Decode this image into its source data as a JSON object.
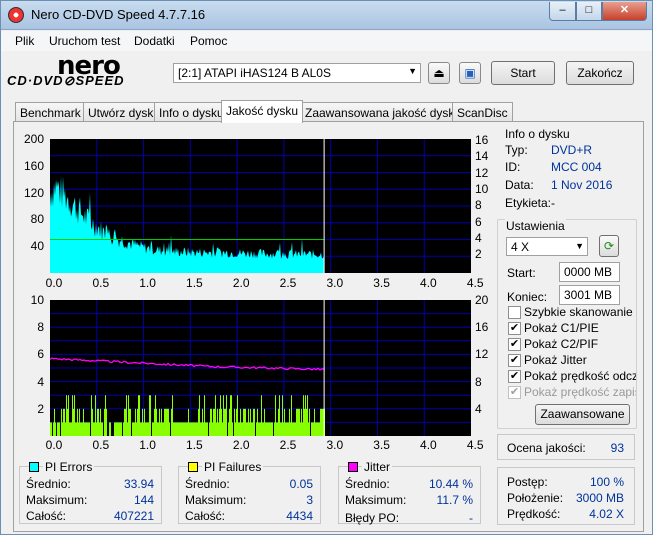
{
  "window": {
    "title": "Nero CD-DVD Speed 4.7.7.16",
    "minimize": "–",
    "maximize": "□",
    "close": "✕"
  },
  "menu": [
    "Plik",
    "Uruchom test",
    "Dodatki",
    "Pomoc"
  ],
  "logo": {
    "line1": "nero",
    "line2": "CD·DVD⊘SPEED"
  },
  "toolbar": {
    "drive": "[2:1]   ATAPI iHAS124   B AL0S",
    "start": "Start",
    "exit": "Zakończ"
  },
  "tabs": [
    "Benchmark",
    "Utwórz dysk",
    "Info o dysku",
    "Jakość dysku",
    "Zaawansowana jakość dysku",
    "ScanDisc"
  ],
  "top_chart": {
    "left_ticks": [
      "200",
      "160",
      "120",
      "80",
      "40"
    ],
    "right_ticks": [
      "16",
      "14",
      "12",
      "10",
      "8",
      "6",
      "4",
      "2"
    ],
    "x_ticks": [
      "0.0",
      "0.5",
      "1.0",
      "1.5",
      "2.0",
      "2.5",
      "3.0",
      "3.5",
      "4.0",
      "4.5"
    ]
  },
  "bottom_chart": {
    "left_ticks": [
      "10",
      "8",
      "6",
      "4",
      "2"
    ],
    "right_ticks": [
      "20",
      "16",
      "12",
      "8",
      "4"
    ],
    "x_ticks": [
      "0.0",
      "0.5",
      "1.0",
      "1.5",
      "2.0",
      "2.5",
      "3.0",
      "3.5",
      "4.0",
      "4.5"
    ]
  },
  "chart_data": [
    {
      "type": "area",
      "x": [
        0.0,
        0.05,
        0.1,
        0.2,
        0.3,
        0.4,
        0.5,
        0.6,
        0.7,
        0.8,
        0.9,
        1.0,
        1.2,
        1.5,
        2.0,
        2.5,
        2.93
      ],
      "series": [
        {
          "values": [
            120,
            130,
            125,
            110,
            95,
            80,
            70,
            58,
            52,
            48,
            42,
            38,
            33,
            31,
            30,
            28,
            28
          ]
        }
      ],
      "markers": [
        {
          "values": [
            50
          ]
        }
      ],
      "xlim": [
        0,
        4.5
      ],
      "ylim": [
        0,
        200
      ],
      "y2lim": [
        0,
        16
      ],
      "colors": {
        "area": "#00ffff",
        "marker": "#00cc00",
        "grid": "#0000aa",
        "cursor": "#ffffff"
      }
    },
    {
      "type": "bar",
      "x_range": [
        0,
        2.93
      ],
      "series": [
        {
          "values": [
            2,
            3,
            1,
            2,
            3,
            1
          ]
        },
        {
          "values": [
            5.7,
            5.5,
            5.3,
            5.1,
            5.0,
            4.9
          ]
        }
      ],
      "xlim": [
        0,
        4.5
      ],
      "ylim": [
        0,
        10
      ],
      "y2lim": [
        0,
        20
      ],
      "colors": {
        "bars": "#88ff00",
        "jitter": "#ff00ff",
        "grid": "#0000aa"
      }
    }
  ],
  "info": {
    "title": "Info o dysku",
    "type_label": "Typ:",
    "type": "DVD+R",
    "id_label": "ID:",
    "id": "MCC 004",
    "date_label": "Data:",
    "date": "1 Nov 2016",
    "label_label": "Etykieta:",
    "label": "-"
  },
  "settings": {
    "title": "Ustawienia",
    "speed": "4 X",
    "start_label": "Start:",
    "start": "0000 MB",
    "end_label": "Koniec:",
    "end": "3001 MB",
    "checkboxes": [
      {
        "label": "Szybkie skanowanie",
        "checked": false,
        "disabled": false
      },
      {
        "label": "Pokaż C1/PIE",
        "checked": true,
        "disabled": false
      },
      {
        "label": "Pokaż C2/PIF",
        "checked": true,
        "disabled": false
      },
      {
        "label": "Pokaż Jitter",
        "checked": true,
        "disabled": false
      },
      {
        "label": "Pokaż prędkość odczytu",
        "checked": true,
        "disabled": false
      },
      {
        "label": "Pokaż prędkość zapisu",
        "checked": true,
        "disabled": true
      }
    ],
    "advanced": "Zaawansowane"
  },
  "quality": {
    "label": "Ocena jakości:",
    "value": "93"
  },
  "progress": {
    "progress_label": "Postęp:",
    "progress": "100 %",
    "position_label": "Położenie:",
    "position": "3000 MB",
    "speed_label": "Prędkość:",
    "speed": "4.02 X"
  },
  "pi_errors": {
    "title": "PI Errors",
    "color": "#00ffff",
    "avg_label": "Średnio:",
    "avg": "33.94",
    "max_label": "Maksimum:",
    "max": "144",
    "total_label": "Całość:",
    "total": "407221"
  },
  "pi_failures": {
    "title": "PI Failures",
    "color": "#ffff00",
    "avg_label": "Średnio:",
    "avg": "0.05",
    "max_label": "Maksimum:",
    "max": "3",
    "total_label": "Całość:",
    "total": "4434"
  },
  "jitter": {
    "title": "Jitter",
    "color": "#ff00ff",
    "avg_label": "Średnio:",
    "avg": "10.44 %",
    "max_label": "Maksimum:",
    "max": "11.7 %",
    "po_label": "Błędy PO:",
    "po": "-"
  }
}
